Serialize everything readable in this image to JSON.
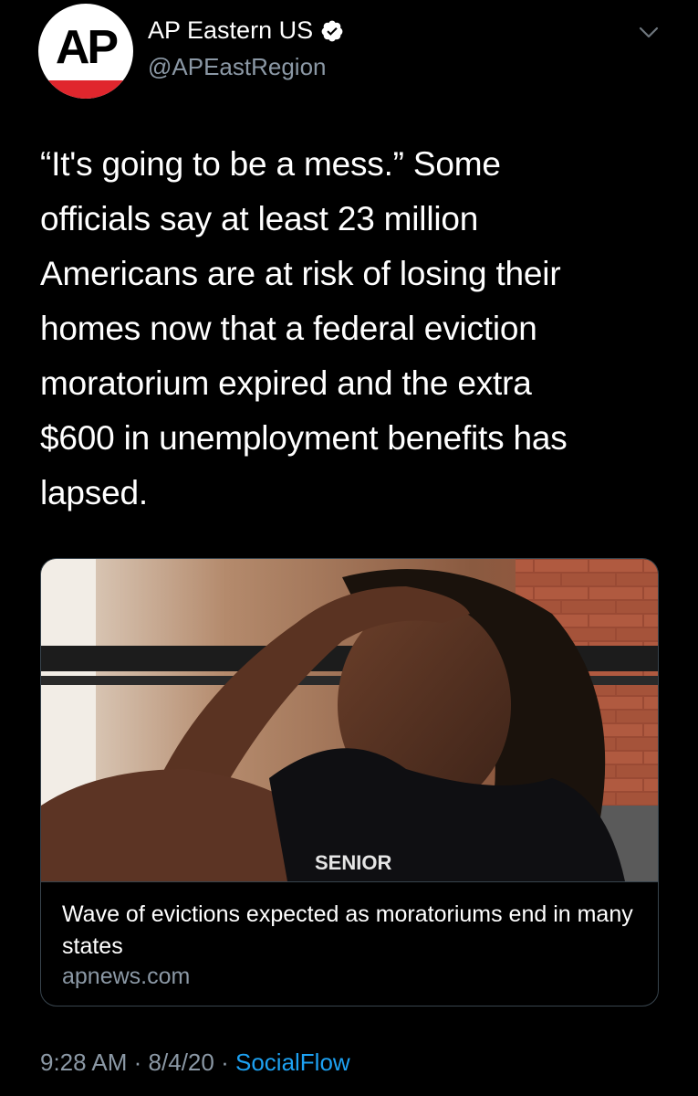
{
  "author": {
    "avatar_text": "AP",
    "display_name": "AP Eastern US",
    "handle": "@APEastRegion",
    "verified": true
  },
  "tweet": {
    "text": "“It's going to be a mess.” Some\nofficials say at least 23 million\nAmericans are at risk of losing their\nhomes now that a federal eviction\nmoratorium expired and the extra\n$600 in unemployment benefits has\nlapsed."
  },
  "card": {
    "title": "Wave of evictions expected as moratoriums end in many states",
    "domain": "apnews.com",
    "image_shirt_text": "SENIOR"
  },
  "footer": {
    "time": "9:28 AM",
    "separator": "·",
    "date": "8/4/20",
    "source": "SocialFlow"
  },
  "colors": {
    "background": "#000000",
    "text": "#ffffff",
    "muted": "#8b98a5",
    "link": "#1da1f2",
    "ap_red": "#e0262d"
  }
}
